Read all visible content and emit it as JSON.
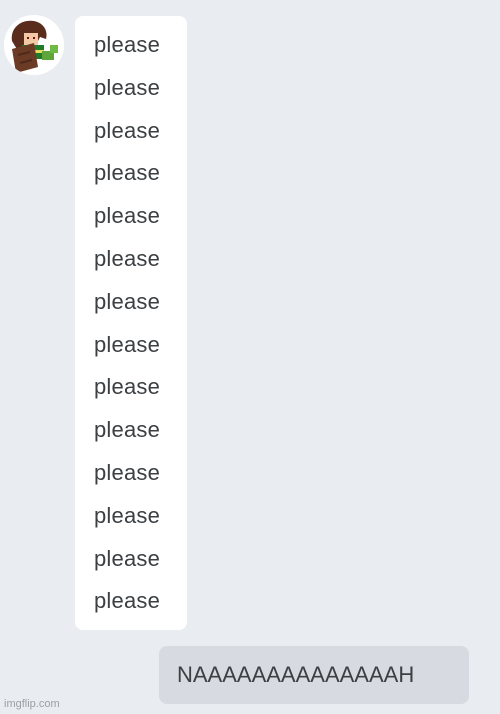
{
  "incoming": {
    "avatar_icon": "character-avatar-icon",
    "messages": [
      "please",
      "please",
      "please",
      "please",
      "please",
      "please",
      "please",
      "please",
      "please",
      "please",
      "please",
      "please",
      "please",
      "please"
    ]
  },
  "outgoing": {
    "text": "NAAAAAAAAAAAAAAH"
  },
  "watermark": "imgflip.com",
  "colors": {
    "background": "#e9ecf0",
    "incoming_bubble": "#ffffff",
    "outgoing_bubble": "#d7dbe1",
    "text": "#3c4043"
  }
}
